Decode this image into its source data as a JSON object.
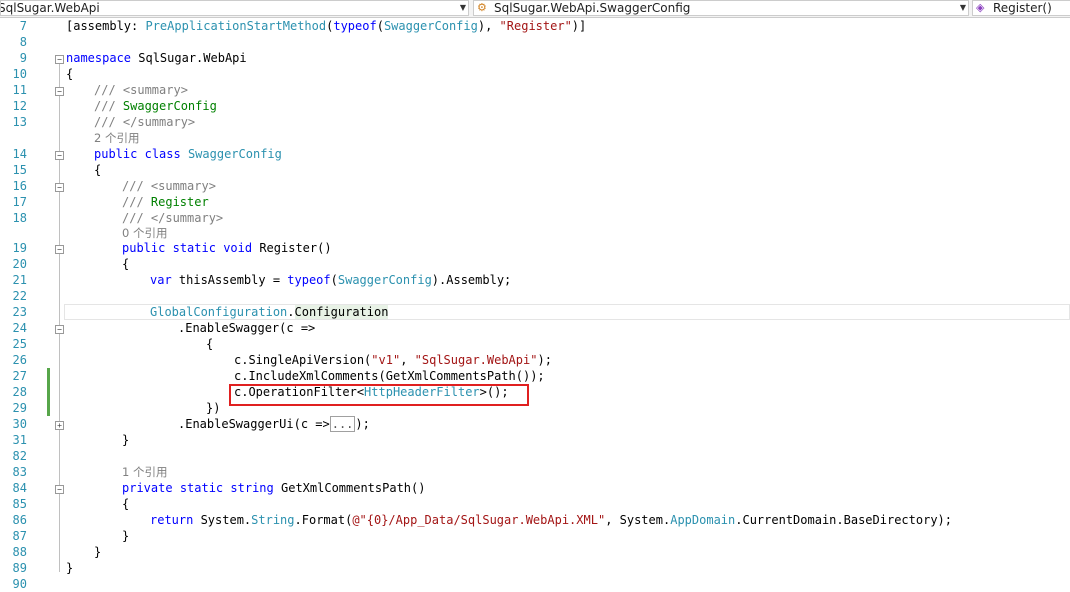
{
  "navbar": {
    "project": "SqlSugar.WebApi",
    "class_scope": "SqlSugar.WebApi.SwaggerConfig",
    "member": "Register()"
  },
  "line_numbers": [
    "7",
    "8",
    "9",
    "10",
    "11",
    "12",
    "13",
    "14",
    "15",
    "16",
    "17",
    "18",
    "19",
    "20",
    "21",
    "22",
    "23",
    "24",
    "25",
    "26",
    "27",
    "28",
    "29",
    "30",
    "31",
    "82",
    "83",
    "84",
    "85",
    "86",
    "87",
    "88",
    "89",
    "90"
  ],
  "hints": {
    "refs_class": "2 个引用",
    "refs_register": "0 个引用",
    "refs_getxml": "1 个引用"
  },
  "code": {
    "l7_a": "[assembly: ",
    "l7_b": "PreApplicationStartMethod",
    "l7_c": "(",
    "l7_d": "typeof",
    "l7_e": "(",
    "l7_f": "SwaggerConfig",
    "l7_g": "), ",
    "l7_h": "\"Register\"",
    "l7_i": ")]",
    "l9_a": "namespace",
    "l9_b": " SqlSugar.WebApi",
    "l10": "{",
    "l11_a": "/// ",
    "l11_b": "<summary>",
    "l12_a": "/// ",
    "l12_b": "SwaggerConfig",
    "l13_a": "/// ",
    "l13_b": "</summary>",
    "l14_a": "public",
    "l14_b": " ",
    "l14_c": "class",
    "l14_d": " ",
    "l14_e": "SwaggerConfig",
    "l15": "{",
    "l16_a": "/// ",
    "l16_b": "<summary>",
    "l17_a": "/// ",
    "l17_b": "Register",
    "l18_a": "/// ",
    "l18_b": "</summary>",
    "l19_a": "public",
    "l19_b": " ",
    "l19_c": "static",
    "l19_d": " ",
    "l19_e": "void",
    "l19_f": " Register()",
    "l20": "{",
    "l21_a": "var",
    "l21_b": " thisAssembly = ",
    "l21_c": "typeof",
    "l21_d": "(",
    "l21_e": "SwaggerConfig",
    "l21_f": ").Assembly;",
    "l23_a": "GlobalConfiguration",
    "l23_b": ".",
    "l23_c": "Configuration",
    "l24": ".EnableSwagger(c =>",
    "l25": "{",
    "l26_a": "c.SingleApiVersion(",
    "l26_b": "\"v1\"",
    "l26_c": ", ",
    "l26_d": "\"SqlSugar.WebApi\"",
    "l26_e": ");",
    "l27": "c.IncludeXmlComments(GetXmlCommentsPath());",
    "l28_a": "c.OperationFilter<",
    "l28_b": "HttpHeaderFilter",
    "l28_c": ">();",
    "l29": "})",
    "l30_a": ".EnableSwaggerUi(c =>",
    "l30_b": "...",
    "l30_c": ");",
    "l31": "}",
    "l84_a": "private",
    "l84_b": " ",
    "l84_c": "static",
    "l84_d": " ",
    "l84_e": "string",
    "l84_f": " GetXmlCommentsPath()",
    "l85": "{",
    "l86_a": "return",
    "l86_b": " System.",
    "l86_c": "String",
    "l86_d": ".Format(",
    "l86_e": "@\"{0}/App_Data/SqlSugar.WebApi.XML\"",
    "l86_f": ", System.",
    "l86_g": "AppDomain",
    "l86_h": ".CurrentDomain.BaseDirectory);",
    "l87": "}",
    "l88": "}",
    "l89": "}"
  },
  "colors": {
    "keyword": "#0000ff",
    "type": "#2b91af",
    "string": "#a31515",
    "comment": "#008000",
    "annotation_box": "#e02020"
  }
}
